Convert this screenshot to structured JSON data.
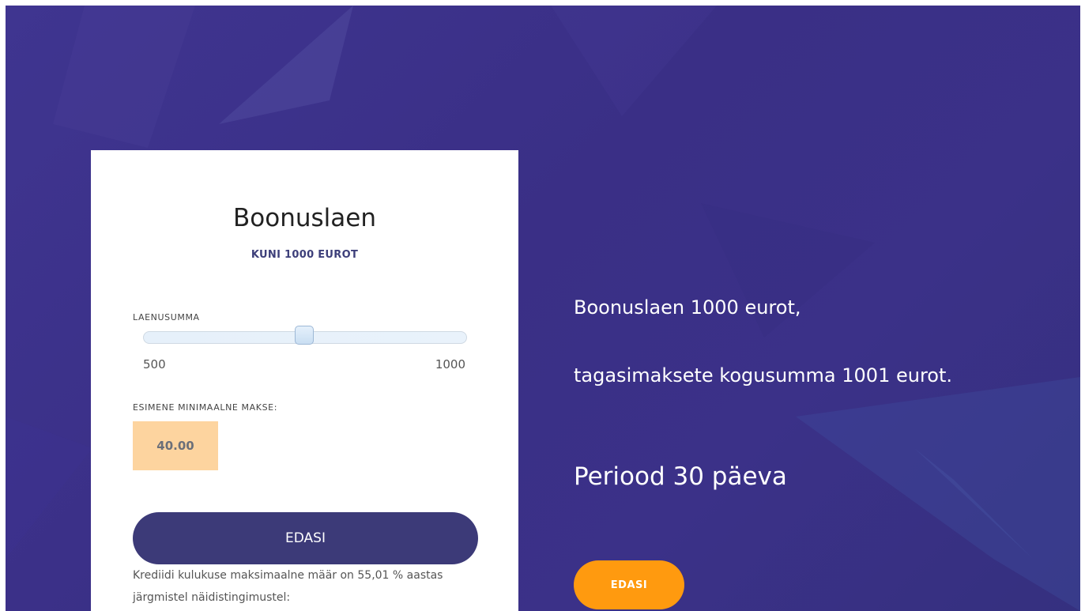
{
  "loan_card": {
    "title": "Boonuslaen",
    "subtitle": "KUNI 1000 EUROT",
    "amount_label": "LAENUSUMMA",
    "slider": {
      "min_label": "500",
      "max_label": "1000",
      "min": 500,
      "max": 1000,
      "value": 750
    },
    "payment_label": "ESIMENE MINIMAALNE MAKSE:",
    "payment_value": "40.00",
    "continue_label": "EDASI",
    "disclaimer": "Krediidi kulukuse maksimaalne määr on 55,01 % aastas järgmistel näidistingimustel:"
  },
  "hero": {
    "line1": "Boonuslaen 1000 eurot,",
    "line2": "tagasimaksete kogusumma 1001 eurot.",
    "line3": "Periood 30 päeva",
    "continue_label": "EDASI"
  },
  "colors": {
    "background": "#3b3188",
    "card_button": "#3c3a78",
    "hero_button": "#ff9a0f",
    "payment_box": "#fdd49f"
  }
}
